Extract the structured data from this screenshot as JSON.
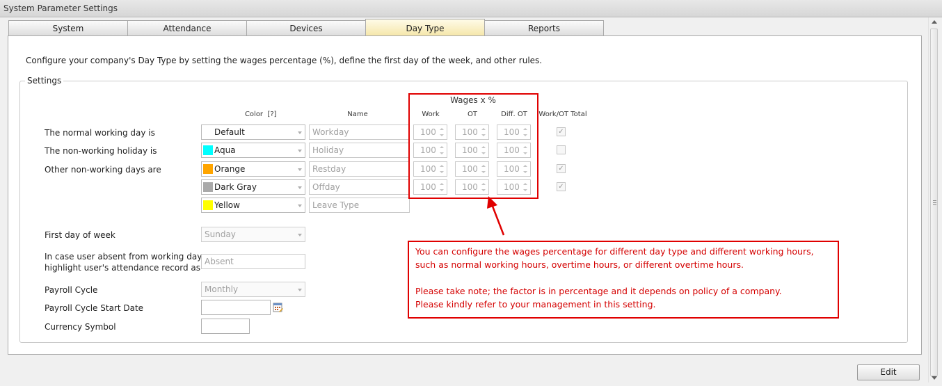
{
  "window": {
    "title": "System Parameter Settings"
  },
  "tabs": [
    {
      "label": "System",
      "active": false
    },
    {
      "label": "Attendance",
      "active": false
    },
    {
      "label": "Devices",
      "active": false
    },
    {
      "label": "Day Type",
      "active": true
    },
    {
      "label": "Reports",
      "active": false
    }
  ],
  "description": "Configure your company's Day Type by setting the wages percentage (%), define the first day of the week, and other rules.",
  "settings": {
    "group_title": "Settings",
    "headers": {
      "color": "Color",
      "color_help": "[?]",
      "name": "Name",
      "wages_title": "Wages x %",
      "work": "Work",
      "ot": "OT",
      "diff_ot": "Diff. OT",
      "work_ot_total": "Work/OT Total"
    },
    "row_labels": {
      "normal": "The normal working day is",
      "holiday": "The non-working holiday is",
      "other": "Other non-working days are"
    },
    "rows": [
      {
        "color_label": "Default",
        "swatch": "#ffffff",
        "name": "Workday",
        "work": "100",
        "ot": "100",
        "diff_ot": "100",
        "work_ot_total": true
      },
      {
        "color_label": "Aqua",
        "swatch": "#00ffff",
        "name": "Holiday",
        "work": "100",
        "ot": "100",
        "diff_ot": "100",
        "work_ot_total": false
      },
      {
        "color_label": "Orange",
        "swatch": "#ffa500",
        "name": "Restday",
        "work": "100",
        "ot": "100",
        "diff_ot": "100",
        "work_ot_total": true
      },
      {
        "color_label": "Dark Gray",
        "swatch": "#a9a9a9",
        "name": "Offday",
        "work": "100",
        "ot": "100",
        "diff_ot": "100",
        "work_ot_total": true
      },
      {
        "color_label": "Yellow",
        "swatch": "#ffff00",
        "name": "Leave Type"
      }
    ],
    "first_day_label": "First day of week",
    "first_day_value": "Sunday",
    "absent_label_1": "In case user absent from working day,",
    "absent_label_2": "highlight user's attendance record as",
    "absent_value": "Absent",
    "payroll_cycle_label": "Payroll Cycle",
    "payroll_cycle_value": "Monthly",
    "payroll_start_label": "Payroll Cycle Start Date",
    "payroll_start_value": "",
    "currency_label": "Currency Symbol",
    "currency_value": ""
  },
  "callout": {
    "line1": "You can configure the wages percentage for different day type and different working hours,",
    "line2": "such as normal working hours, overtime hours, or different overtime hours.",
    "line3": "Please take note; the factor is in percentage and it depends on policy of a company.",
    "line4": "Please kindly refer to your management in this setting."
  },
  "footer": {
    "edit_label": "Edit"
  },
  "colors": {
    "annotation": "#e00000",
    "active_tab": "#f5e6a8"
  }
}
